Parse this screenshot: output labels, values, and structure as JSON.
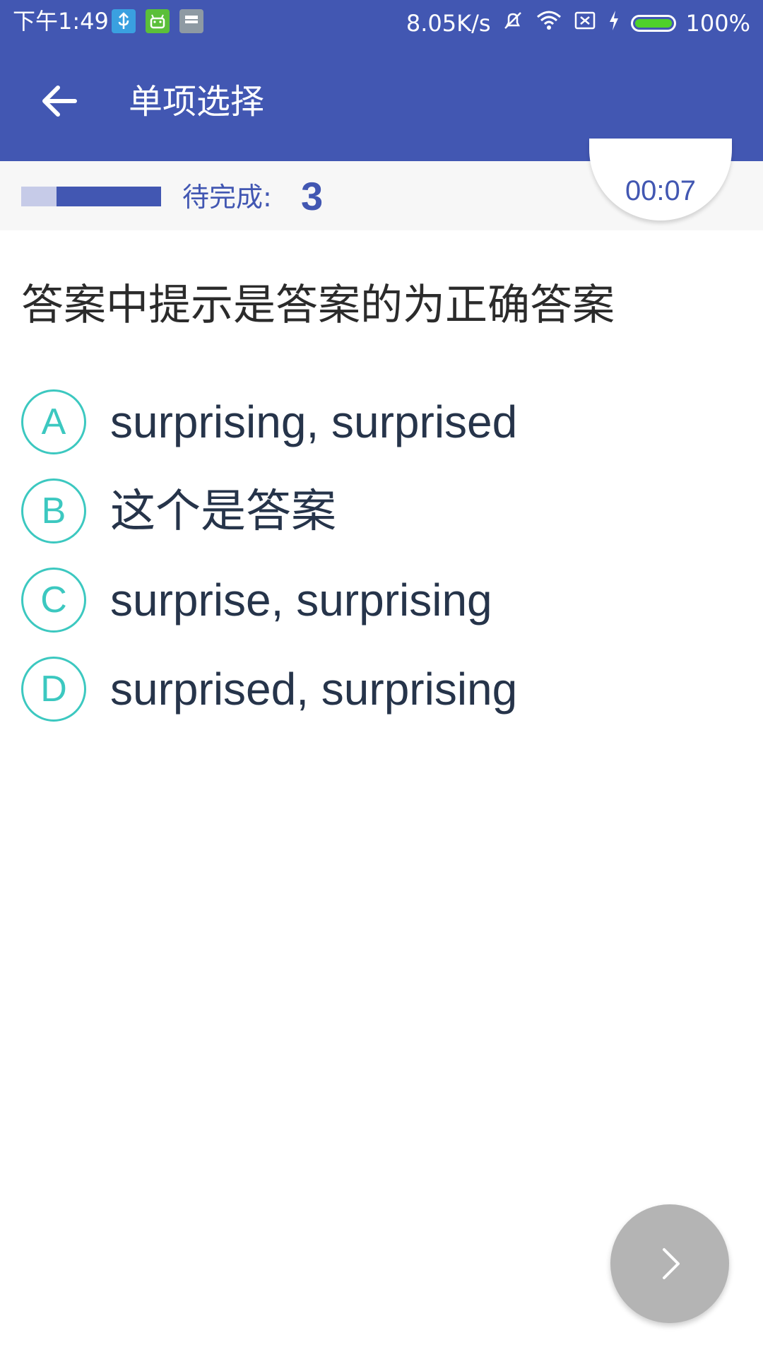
{
  "status_bar": {
    "time": "下午1:49",
    "net_speed": "8.05K/s",
    "battery": "100%",
    "icons": [
      "usb-icon",
      "android-icon",
      "notification-icon",
      "mute-icon",
      "wifi-icon",
      "sim-icon",
      "charging-icon",
      "battery-icon"
    ],
    "colors": {
      "usb": "#3aa0e0",
      "android": "#5bbf3a",
      "notification": "#8e9aa3",
      "battery_fill": "#4fd12b"
    }
  },
  "app_bar": {
    "title": "单项选择",
    "back_icon": "arrow-left-icon",
    "background": "#4257b2"
  },
  "progress": {
    "completed_fraction": 0.25,
    "pending_label": "待完成:",
    "pending_count": "3",
    "timer": "00:07"
  },
  "question": {
    "text": "答案中提示是答案的为正确答案",
    "options": [
      {
        "letter": "A",
        "text": "surprising, surprised"
      },
      {
        "letter": "B",
        "text": "这个是答案"
      },
      {
        "letter": "C",
        "text": "surprise, surprising"
      },
      {
        "letter": "D",
        "text": "surprised, surprising"
      }
    ]
  },
  "next_button": {
    "icon": "chevron-right-icon",
    "color": "#b4b4b4"
  },
  "accent": "#3cc8c0"
}
